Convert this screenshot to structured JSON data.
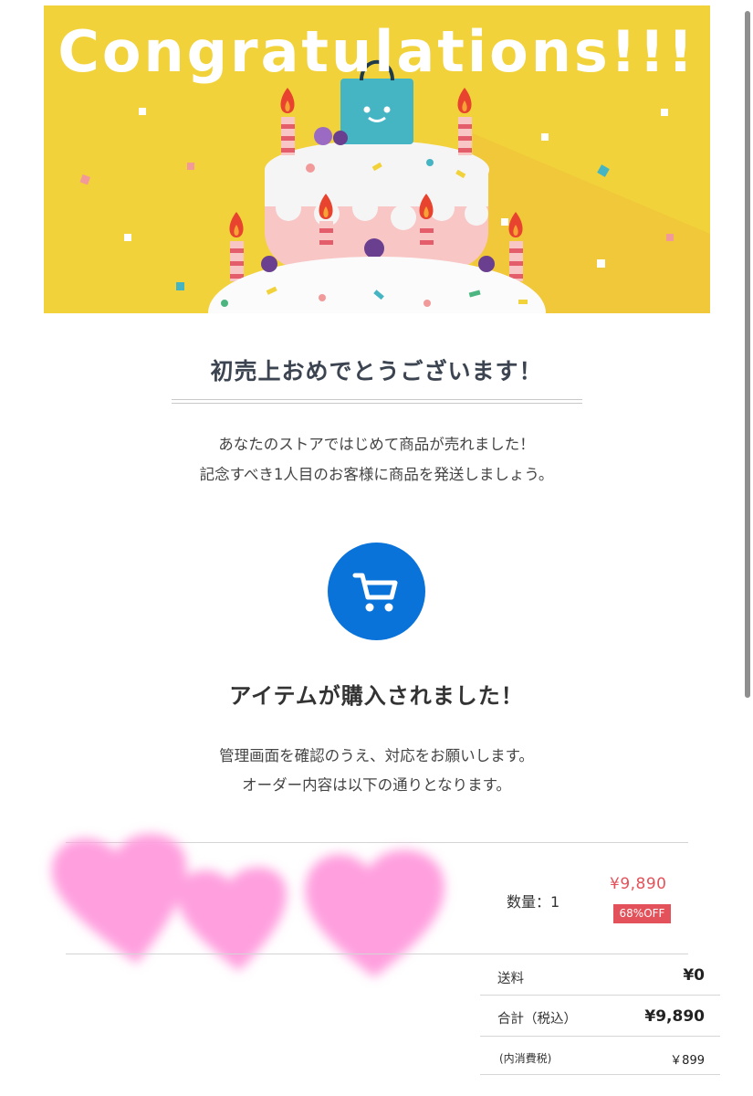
{
  "banner": {
    "title": "Congratulations!!!",
    "background_color": "#f2d23a"
  },
  "headline": "初売上おめでとうございます！",
  "intro": {
    "line1": "あなたのストアではじめて商品が売れました！",
    "line2": "記念すべき1人目のお客様に商品を発送しましょう。"
  },
  "cart_icon": {
    "icon": "shopping-cart-icon",
    "color": "#0a73d9"
  },
  "item_section": {
    "title": "アイテムが購入されました！",
    "line1": "管理画面を確認のうえ、対応をお願いします。",
    "line2": "オーダー内容は以下の通りとなります。"
  },
  "order_item": {
    "quantity_label": "数量：1",
    "price": "¥9,890",
    "discount_badge": "68%OFF",
    "accent_color": "#e3525a"
  },
  "summary": {
    "shipping_label": "送料",
    "shipping_value": "¥0",
    "total_label": "合計（税込）",
    "total_value": "¥9,890",
    "tax_label": "(内消費税)",
    "tax_value": "￥899"
  }
}
